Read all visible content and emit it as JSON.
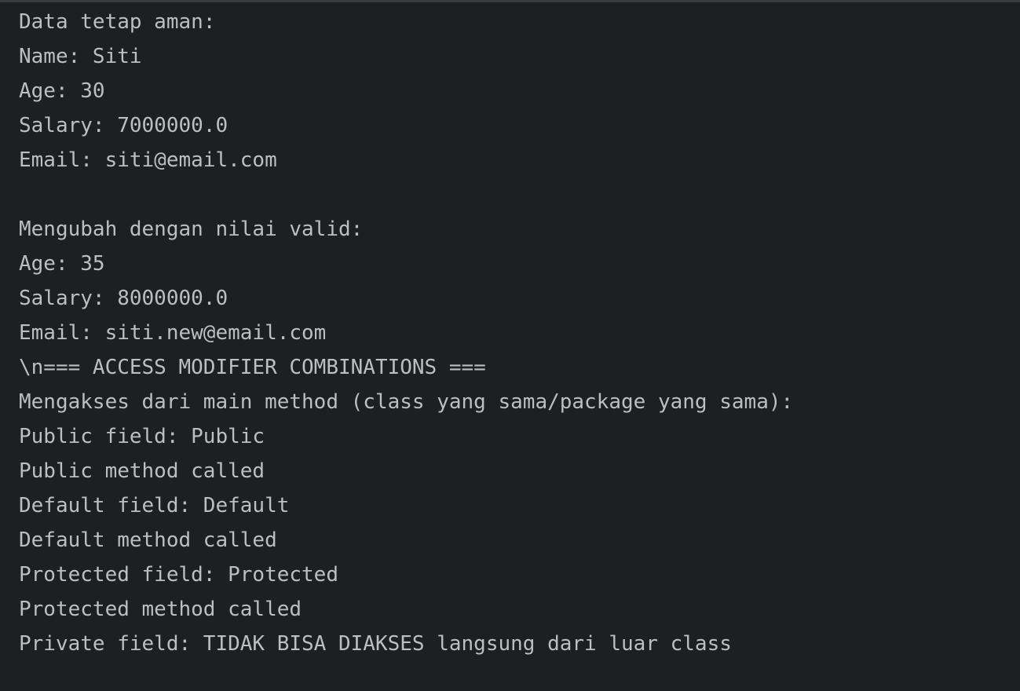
{
  "console": {
    "lines": [
      "Data tetap aman:",
      "Name: Siti",
      "Age: 30",
      "Salary: 7000000.0",
      "Email: siti@email.com",
      "",
      "Mengubah dengan nilai valid:",
      "Age: 35",
      "Salary: 8000000.0",
      "Email: siti.new@email.com",
      "\\n=== ACCESS MODIFIER COMBINATIONS ===",
      "Mengakses dari main method (class yang sama/package yang sama):",
      "Public field: Public",
      "Public method called",
      "Default field: Default",
      "Default method called",
      "Protected field: Protected",
      "Protected method called",
      "Private field: TIDAK BISA DIAKSES langsung dari luar class"
    ]
  },
  "theme": {
    "background": "#1e1f22",
    "text": "#bcbec4",
    "top_border": "#393b40"
  }
}
